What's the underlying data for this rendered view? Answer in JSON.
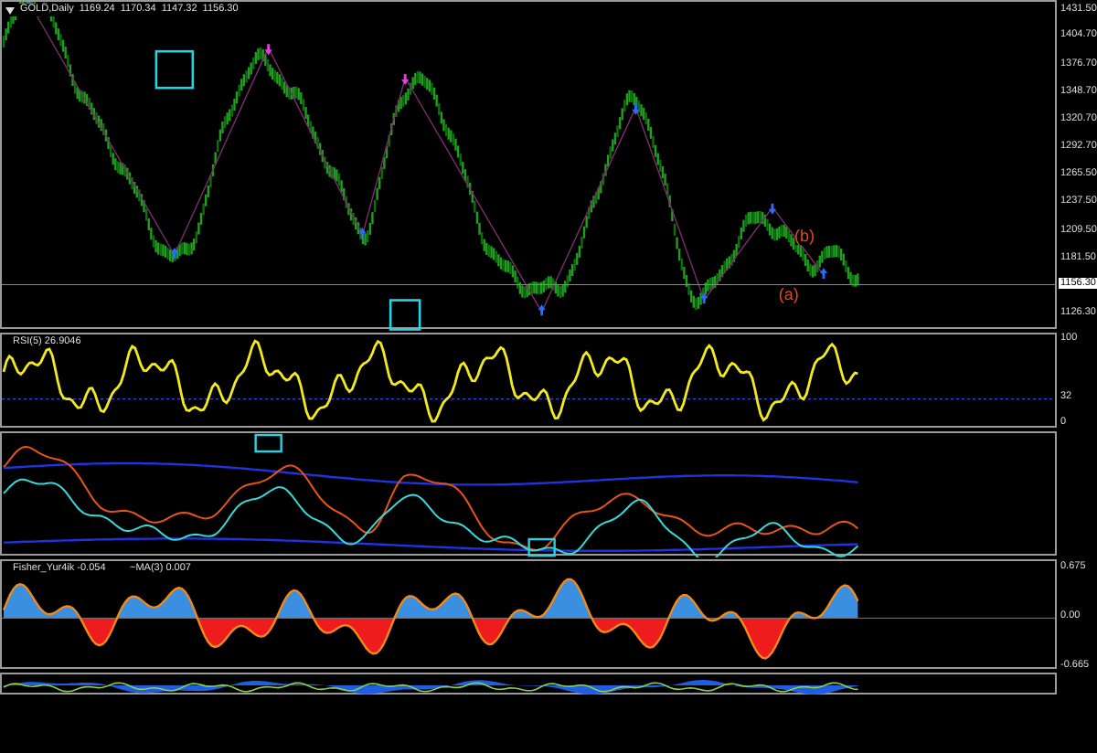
{
  "chart": {
    "symbol": "GOLD,Daily",
    "ohlc": [
      "1169.24",
      "1170.34",
      "1147.32",
      "1156.30"
    ],
    "price_axis": [
      "1431.50",
      "1404.70",
      "1376.70",
      "1348.70",
      "1320.70",
      "1292.70",
      "1265.50",
      "1237.50",
      "1209.50",
      "1181.50",
      "1126.30"
    ],
    "current_price": "1156.30",
    "wave_labels": [
      "(a)",
      "(b)"
    ]
  },
  "panels": [
    {
      "kind": "rsi",
      "label": "RSI(5) 26.9046",
      "axis": [
        "100",
        "32",
        "0"
      ]
    },
    {
      "kind": "bands"
    },
    {
      "kind": "fisher",
      "label": "Fisher_Yur4ik -0.054",
      "label_2": "~MA(3) 0.007",
      "axis": [
        "0.675",
        "0.00",
        "-0.665"
      ]
    },
    {
      "kind": "mini"
    }
  ]
}
